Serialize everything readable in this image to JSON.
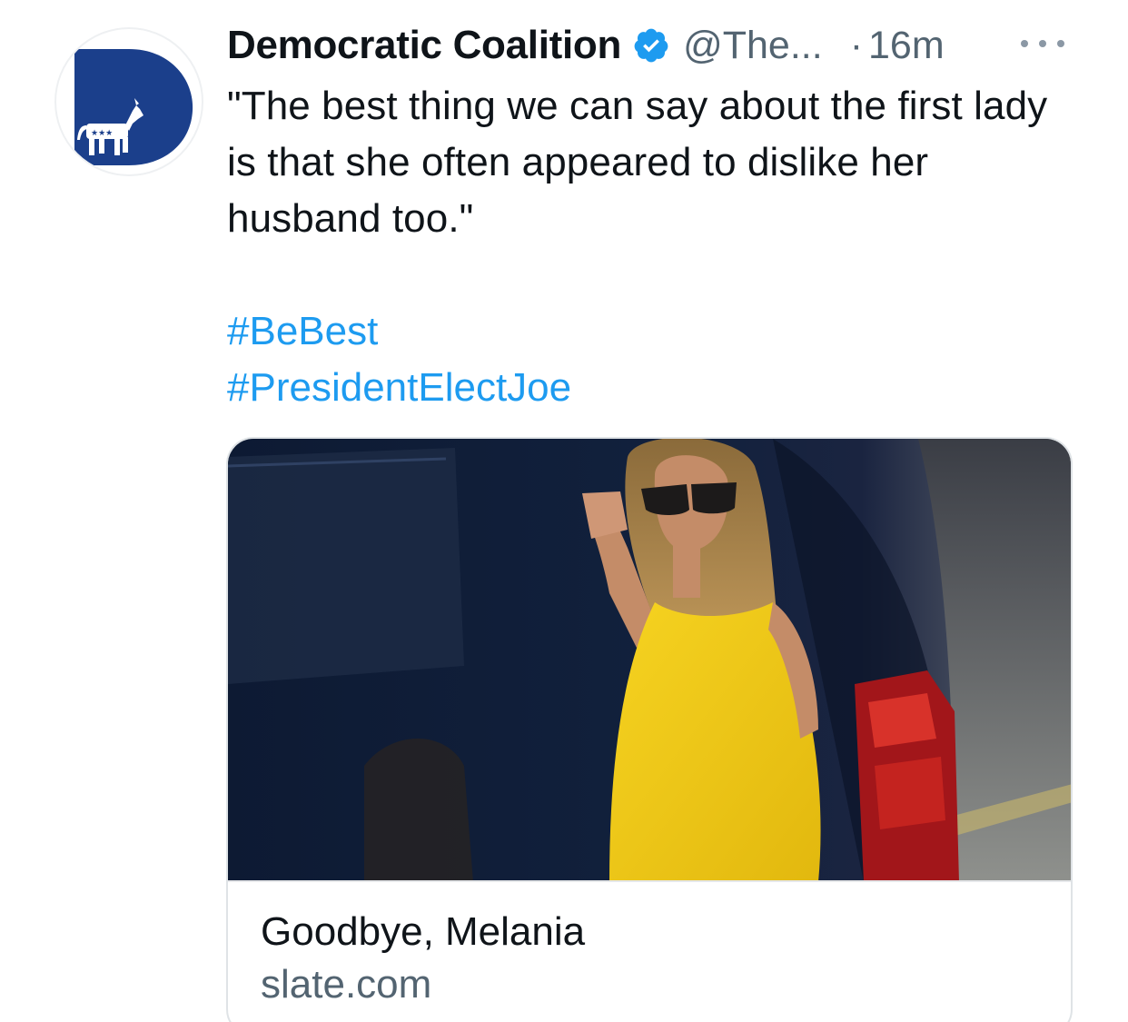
{
  "tweet": {
    "author_name": "Democratic Coalition",
    "handle": "@The...",
    "separator": "·",
    "time": "16m",
    "text": "\"The best thing we can say about the first lady is that she often appeared to dislike her husband too.\"",
    "hashtags": [
      "#BeBest",
      "#PresidentElectJoe"
    ],
    "icons": {
      "avatar": "democratic-donkey-logo",
      "verified": "verified-badge-icon",
      "more": "more-options-icon"
    }
  },
  "card": {
    "title": "Goodbye, Melania",
    "domain": "slate.com",
    "image": "photo-woman-yellow-dress-waving"
  },
  "colors": {
    "link": "#1d9bf0",
    "secondary_text": "#536471",
    "avatar_blue": "#1b3f8b"
  }
}
